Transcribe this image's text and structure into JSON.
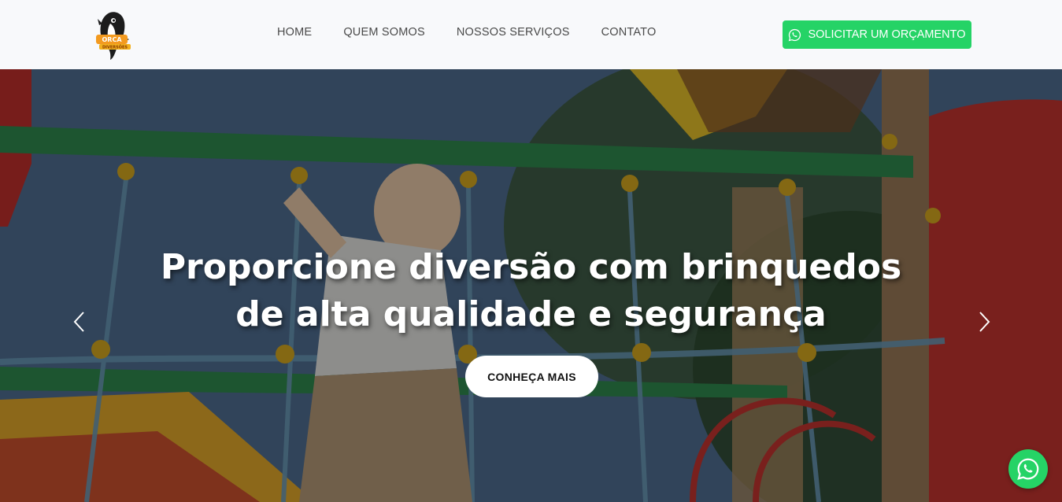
{
  "header": {
    "logo_text": "ORCA DIVERSÕES",
    "nav": [
      {
        "label": "HOME"
      },
      {
        "label": "QUEM SOMOS"
      },
      {
        "label": "NOSSOS SERVIÇOS"
      },
      {
        "label": "CONTATO"
      }
    ],
    "cta_label": "SOLICITAR UM ORÇAMENTO",
    "cta_icon": "whatsapp-icon"
  },
  "hero": {
    "headline_line1": "Proporcione diversão com brinquedos",
    "headline_line2": "de alta qualidade e segurança",
    "button_label": "CONHEÇA MAIS",
    "prev_icon": "chevron-left-icon",
    "next_icon": "chevron-right-icon"
  },
  "floating": {
    "whatsapp_icon": "whatsapp-icon"
  },
  "colors": {
    "whatsapp_green": "#25d366",
    "header_bg": "#f8f9fb",
    "nav_text": "#4a4a4a"
  }
}
